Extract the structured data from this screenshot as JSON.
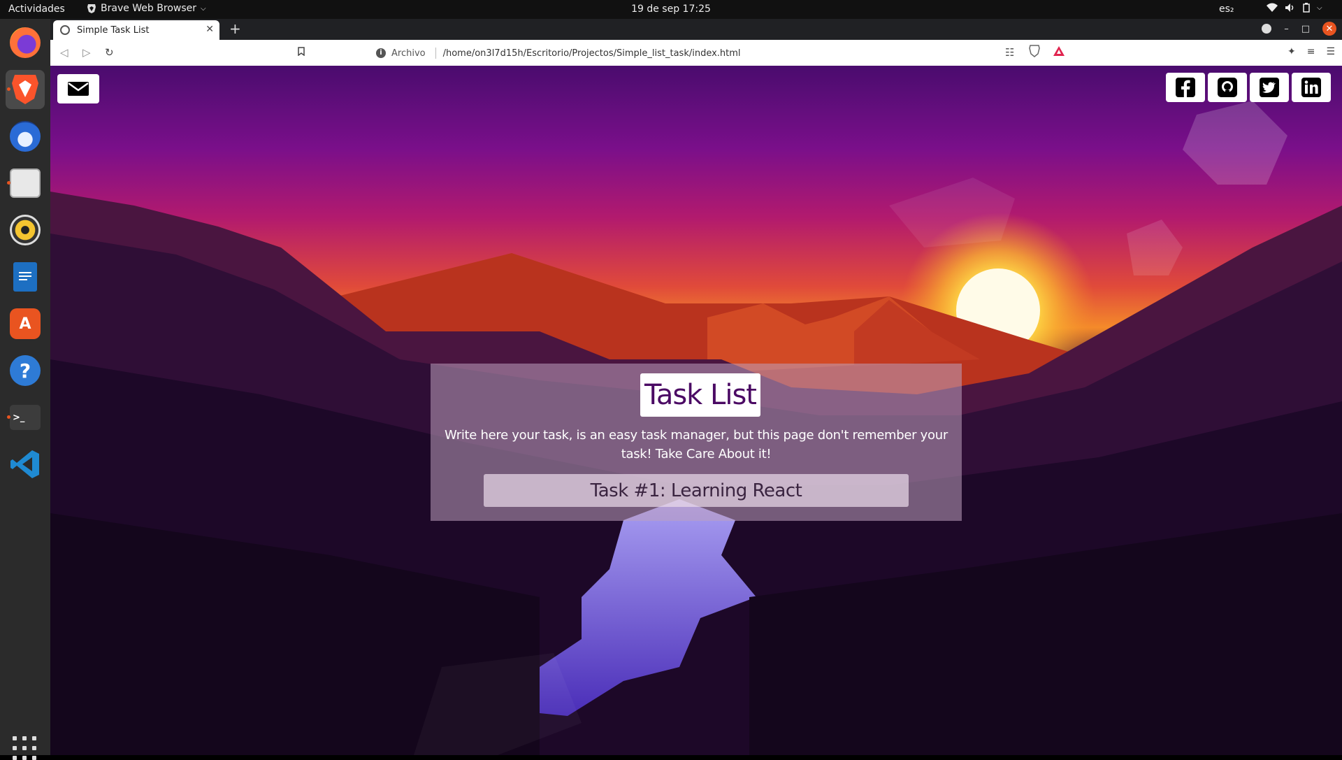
{
  "desktop": {
    "activities": "Actividades",
    "app_menu": "Brave Web Browser",
    "clock": "19 de sep  17:25",
    "language": "es₂"
  },
  "dock": {
    "apps": [
      {
        "name": "Firefox",
        "icon": "firefox-icon"
      },
      {
        "name": "Brave",
        "icon": "brave-icon"
      },
      {
        "name": "Thunderbird",
        "icon": "thunderbird-icon"
      },
      {
        "name": "Files",
        "icon": "files-icon"
      },
      {
        "name": "Rhythmbox",
        "icon": "rhythmbox-icon"
      },
      {
        "name": "LibreOffice Writer",
        "icon": "writer-icon"
      },
      {
        "name": "Ubuntu Software",
        "icon": "software-icon"
      },
      {
        "name": "Help",
        "icon": "help-icon"
      },
      {
        "name": "Terminal",
        "icon": "terminal-icon"
      },
      {
        "name": "VS Code",
        "icon": "vscode-icon"
      }
    ]
  },
  "browser": {
    "tab_title": "Simple Task List",
    "scheme_label": "Archivo",
    "url": "/home/on3l7d15h/Escritorio/Projectos/Simple_list_task/index.html"
  },
  "page": {
    "title": "Task List",
    "description": "Write here your task, is an easy task manager, but this page don't remember your task! Take Care About it!",
    "tasks": [
      "Task #1: Learning React"
    ],
    "socials": [
      "facebook-icon",
      "github-icon",
      "twitter-icon",
      "linkedin-icon"
    ]
  },
  "colors": {
    "title": "#4b0a64",
    "accent": "#e95420"
  }
}
